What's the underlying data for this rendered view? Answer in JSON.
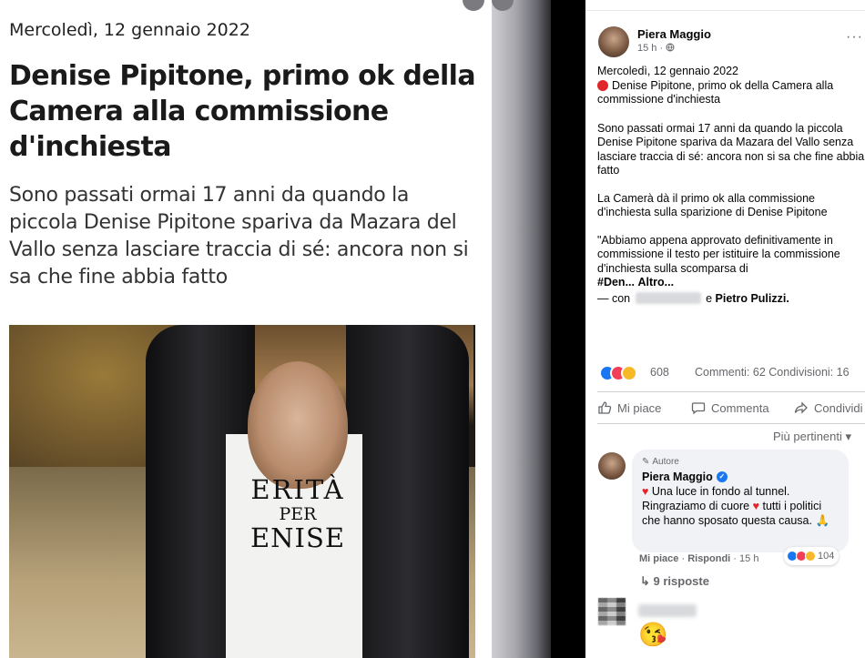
{
  "article": {
    "date": "Mercoledì, 12 gennaio 2022",
    "title": "Denise Pipitone, primo ok della Camera alla commissione d'inchiesta",
    "subtitle": "Sono passati ormai 17 anni da quando la piccola Denise Pipitone spariva da Mazara del Vallo senza lasciare traccia di sé: ancora non si sa che fine abbia fatto",
    "photo_shirt_line1": "ERITÀ",
    "photo_shirt_line2": "PER",
    "photo_shirt_line3": "ENISE"
  },
  "post": {
    "author": "Piera Maggio",
    "time": "15 h ·",
    "privacy_icon": "globe-icon",
    "more": "···",
    "date_line": "Mercoledì, 12 gennaio 2022",
    "headline": "Denise Pipitone, primo ok della Camera alla commissione d'inchiesta",
    "paragraph1": "Sono passati ormai 17 anni da quando la piccola Denise Pipitone spariva da Mazara del Vallo senza lasciare traccia di sé: ancora non si sa che fine abbia fatto",
    "paragraph2": "La Camerà dà il primo ok alla commissione d'inchiesta sulla sparizione di Denise Pipitone",
    "paragraph3": "\"Abbiamo appena approvato definitivamente in commissione il testo per istituire la commissione d'inchiesta sulla scomparsa di",
    "hashtag": "#Den...",
    "more_link": "Altro...",
    "with_prefix": "— con",
    "with_and": "e",
    "with_tagged": "Pietro Pulizzi."
  },
  "reactions": {
    "count": "608",
    "stats": "Commenti: 62  Condivisioni: 16"
  },
  "actions": {
    "like": "Mi piace",
    "comment": "Commenta",
    "share": "Condividi"
  },
  "sort": {
    "label": "Più pertinenti"
  },
  "comment": {
    "badge": "Autore",
    "author": "Piera Maggio",
    "text1": "Una luce in fondo al tunnel.",
    "text2": "Ringraziamo di cuore",
    "text3": "tutti i politici che hanno sposato questa causa.",
    "like": "Mi piace",
    "reply": "Rispondi",
    "time": "15 h",
    "react_count": "104",
    "replies": "9 risposte"
  },
  "colors": {
    "facebook_blue": "#1877f2",
    "love_red": "#f33e58",
    "care_yellow": "#f7b928",
    "live_dot": "#e0262b"
  }
}
